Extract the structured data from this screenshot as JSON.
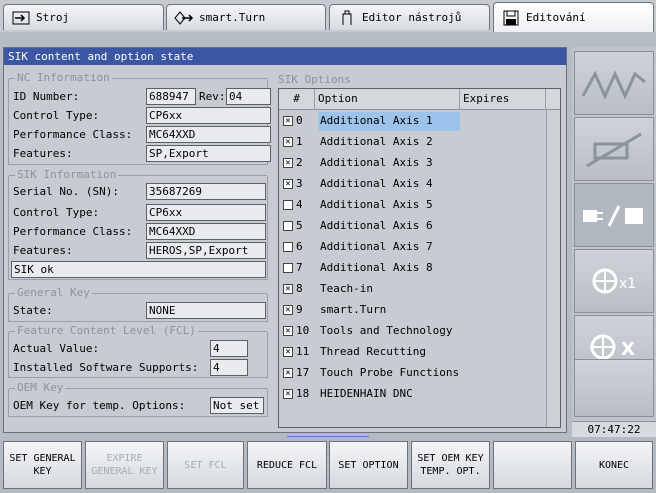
{
  "tabs": [
    {
      "label": "Stroj",
      "icon": "arrow-right-icon"
    },
    {
      "label": "smart.Turn",
      "icon": "diamond-arrow-icon"
    },
    {
      "label": "Editor nástrojů",
      "icon": "tool-icon"
    },
    {
      "label": "Editování",
      "icon": "save-icon"
    }
  ],
  "dialog": {
    "title": "SIK content and option state",
    "nc": {
      "legend": "NC Information",
      "id_label": "ID Number:",
      "id_value": "688947",
      "rev_label": "Rev:",
      "rev_value": "04",
      "control_label": "Control Type:",
      "control_value": "CP6xx",
      "perf_label": "Performance Class:",
      "perf_value": "MC64XXD",
      "features_label": "Features:",
      "features_value": "SP,Export"
    },
    "sik": {
      "legend": "SIK Information",
      "serial_label": "Serial No. (SN):",
      "serial_value": "35687269",
      "control_label": "Control Type:",
      "control_value": "CP6xx",
      "perf_label": "Performance Class:",
      "perf_value": "MC64XXD",
      "features_label": "Features:",
      "features_value": "HEROS,SP,Export",
      "status": "SIK ok"
    },
    "general_key": {
      "legend": "General Key",
      "state_label": "State:",
      "state_value": "NONE"
    },
    "fcl": {
      "legend": "Feature Content Level (FCL)",
      "actual_label": "Actual Value:",
      "actual_value": "4",
      "installed_label": "Installed Software Supports:",
      "installed_value": "4"
    },
    "oem": {
      "legend": "OEM Key",
      "temp_label": "OEM Key for temp. Options:",
      "temp_value": "Not set"
    },
    "options": {
      "legend": "SIK Options",
      "col_num": "#",
      "col_option": "Option",
      "col_expires": "Expires",
      "rows": [
        {
          "checked": true,
          "num": "0",
          "name": "Additional Axis 1",
          "selected": true
        },
        {
          "checked": true,
          "num": "1",
          "name": "Additional Axis 2"
        },
        {
          "checked": true,
          "num": "2",
          "name": "Additional Axis 3"
        },
        {
          "checked": true,
          "num": "3",
          "name": "Additional Axis 4"
        },
        {
          "checked": false,
          "num": "4",
          "name": "Additional Axis 5"
        },
        {
          "checked": false,
          "num": "5",
          "name": "Additional Axis 6"
        },
        {
          "checked": false,
          "num": "6",
          "name": "Additional Axis 7"
        },
        {
          "checked": false,
          "num": "7",
          "name": "Additional Axis 8"
        },
        {
          "checked": true,
          "num": "8",
          "name": "Teach-in"
        },
        {
          "checked": true,
          "num": "9",
          "name": "smart.Turn"
        },
        {
          "checked": true,
          "num": "10",
          "name": "Tools and Technology"
        },
        {
          "checked": true,
          "num": "11",
          "name": "Thread Recutting"
        },
        {
          "checked": true,
          "num": "17",
          "name": "Touch Probe Functions"
        },
        {
          "checked": true,
          "num": "18",
          "name": "HEIDENHAIN DNC"
        }
      ]
    }
  },
  "right_panel": {
    "buttons": [
      {
        "icon": "zigzag-feed-icon"
      },
      {
        "icon": "cross-out-tool-icon"
      },
      {
        "icon": "plug-icon"
      },
      {
        "icon": "rapid-x1-icon",
        "label": "x1"
      },
      {
        "icon": "rapid-x-icon",
        "label": "X"
      },
      {
        "icon": "empty"
      }
    ],
    "clock": "07:47:22"
  },
  "softkeys": [
    {
      "label": "SET GENERAL KEY",
      "enabled": true
    },
    {
      "label": "EXPIRE GENERAL KEY",
      "enabled": false
    },
    {
      "label": "SET FCL",
      "enabled": false
    },
    {
      "label": "REDUCE FCL",
      "enabled": true
    },
    {
      "label": "SET OPTION",
      "enabled": true
    },
    {
      "label": "SET OEM KEY TEMP. OPT.",
      "enabled": true
    },
    {
      "label": "",
      "enabled": false
    },
    {
      "label": "KONEC",
      "enabled": true
    }
  ]
}
